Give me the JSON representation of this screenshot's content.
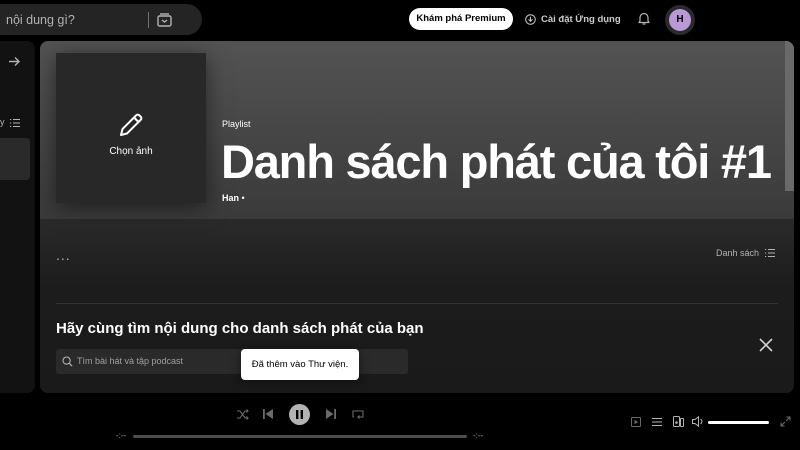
{
  "topbar": {
    "search_text": "nội dung gì?",
    "premium_label": "Khám phá Premium",
    "install_label": "Cài đặt Ứng dụng",
    "avatar_initial": "H"
  },
  "sidebar": {
    "sort_label": "y"
  },
  "playlist": {
    "cover_label": "Chọn ảnh",
    "type": "Playlist",
    "title": "Danh sách phát của tôi #1",
    "owner": "Han",
    "owner_suffix": "•"
  },
  "actions": {
    "more": "...",
    "view_label": "Danh sách"
  },
  "find": {
    "heading": "Hãy cùng tìm nội dung cho danh sách phát của bạn",
    "placeholder": "Tìm bài hát và tập podcast"
  },
  "toast": {
    "message": "Đã thêm vào Thư viện."
  },
  "player": {
    "time_elapsed": "-:--",
    "time_total": "-:--",
    "volume_level": 1.0
  },
  "colors": {
    "accent": "#ffffff",
    "avatar_bg": "#b99ad6",
    "hero_top": "#535353",
    "background": "#000000"
  }
}
